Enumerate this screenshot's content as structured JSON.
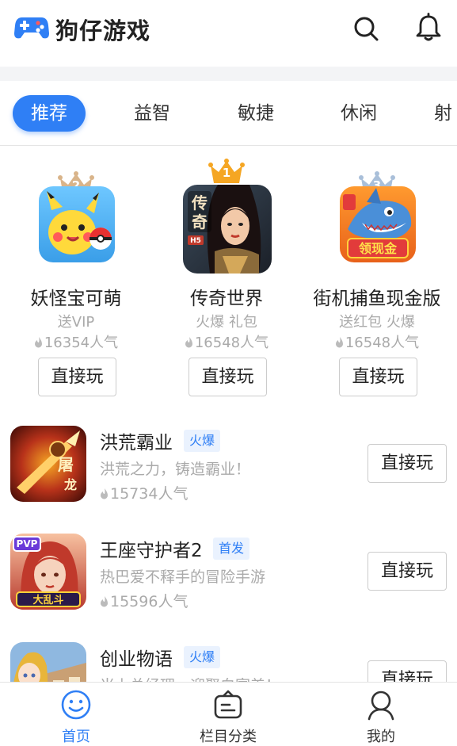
{
  "header": {
    "app_title": "狗仔游戏",
    "logo_icon": "gamepad-icon",
    "search_icon": "search-icon",
    "notification_icon": "bell-icon"
  },
  "tabs": [
    {
      "label": "推荐",
      "active": true
    },
    {
      "label": "益智",
      "active": false
    },
    {
      "label": "敏捷",
      "active": false
    },
    {
      "label": "休闲",
      "active": false
    },
    {
      "label": "射",
      "active": false
    }
  ],
  "top_games": [
    {
      "rank": "2",
      "name": "妖怪宝可萌",
      "tags": "送VIP",
      "popularity": "16354人气",
      "button": "直接玩",
      "crown_color": "#d9b48a"
    },
    {
      "rank": "1",
      "name": "传奇世界",
      "tags": "火爆 礼包",
      "popularity": "16548人气",
      "button": "直接玩",
      "crown_color": "#f5a623"
    },
    {
      "rank": "3",
      "name": "街机捕鱼现金版",
      "tags": "送红包 火爆",
      "popularity": "16548人气",
      "button": "直接玩",
      "crown_color": "#a9bfd9"
    }
  ],
  "games": [
    {
      "name": "洪荒霸业",
      "badge": "火爆",
      "desc": "洪荒之力，铸造霸业！",
      "popularity": "15734人气",
      "button": "直接玩"
    },
    {
      "name": "王座守护者2",
      "badge": "首发",
      "desc": "热巴爱不释手的冒险手游",
      "popularity": "15596人气",
      "button": "直接玩"
    },
    {
      "name": "创业物语",
      "badge": "火爆",
      "desc": "当上总经理，迎娶白富美！",
      "popularity": "",
      "button": "直接玩"
    }
  ],
  "bottom_nav": [
    {
      "label": "首页",
      "icon": "smiley-icon",
      "active": true
    },
    {
      "label": "栏目分类",
      "icon": "category-box-icon",
      "active": false
    },
    {
      "label": "我的",
      "icon": "user-icon",
      "active": false
    }
  ],
  "colors": {
    "accent": "#2f7ff5",
    "muted_text": "#aaaaaa",
    "badge_bg": "#eaf2fe"
  }
}
